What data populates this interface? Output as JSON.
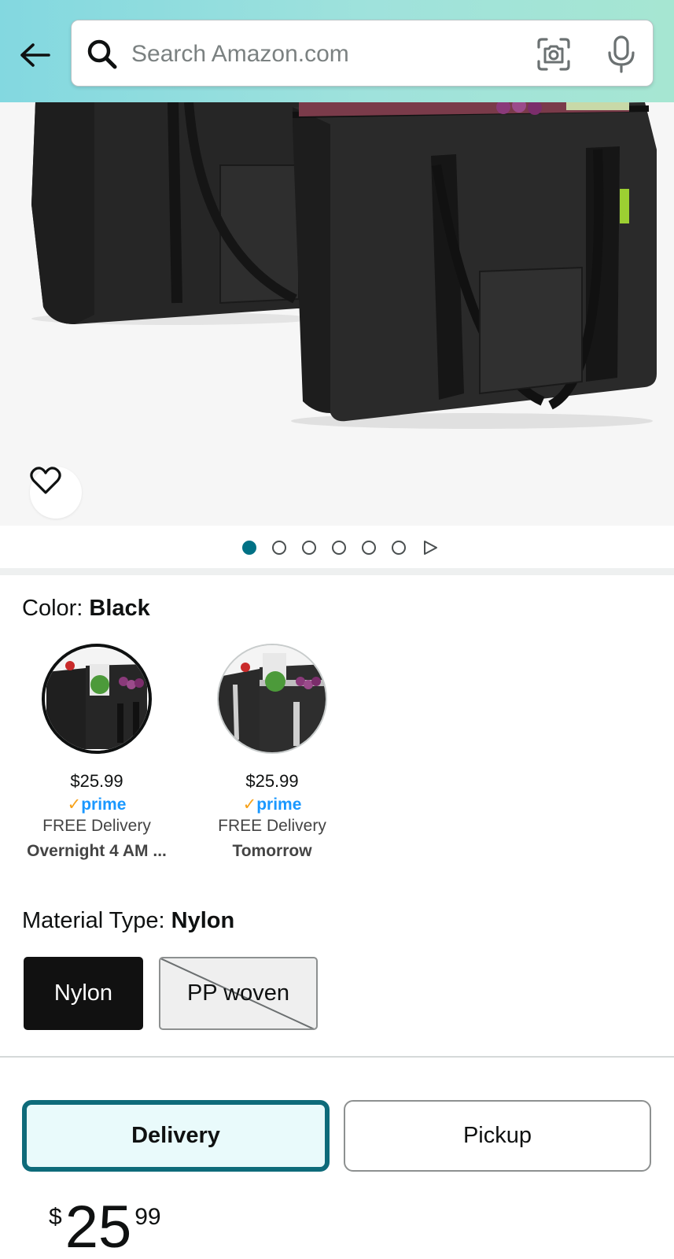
{
  "header": {
    "search_placeholder": "Search Amazon.com",
    "icons": [
      "back-arrow-icon",
      "search-icon",
      "camera-icon",
      "microphone-icon"
    ]
  },
  "gallery": {
    "image_count": 6,
    "active_index": 0,
    "wishlist_icon": "heart-icon",
    "next_icon": "play-icon"
  },
  "color": {
    "label": "Color: ",
    "selected": "Black",
    "options": [
      {
        "price": "$25.99",
        "prime_check": "✓",
        "prime": "prime",
        "delivery": "FREE Delivery",
        "when": "Overnight 4 AM ...",
        "selected": true
      },
      {
        "price": "$25.99",
        "prime_check": "✓",
        "prime": "prime",
        "delivery": "FREE Delivery",
        "when": "Tomorrow",
        "selected": false
      }
    ]
  },
  "material": {
    "label": "Material Type: ",
    "selected": "Nylon",
    "options": [
      {
        "label": "Nylon",
        "state": "selected"
      },
      {
        "label": "PP woven",
        "state": "unavailable"
      }
    ]
  },
  "fulfillment": {
    "delivery_label": "Delivery",
    "pickup_label": "Pickup",
    "selected": "Delivery"
  },
  "price": {
    "symbol": "$",
    "whole": "25",
    "fraction": "99"
  },
  "colors": {
    "accent_teal": "#007185",
    "delivery_border": "#0e6b7a",
    "prime_blue": "#1a98ff",
    "prime_check": "#f7a21a",
    "header_gradient_start": "#83d8e0",
    "header_gradient_end": "#a6e6d2"
  }
}
